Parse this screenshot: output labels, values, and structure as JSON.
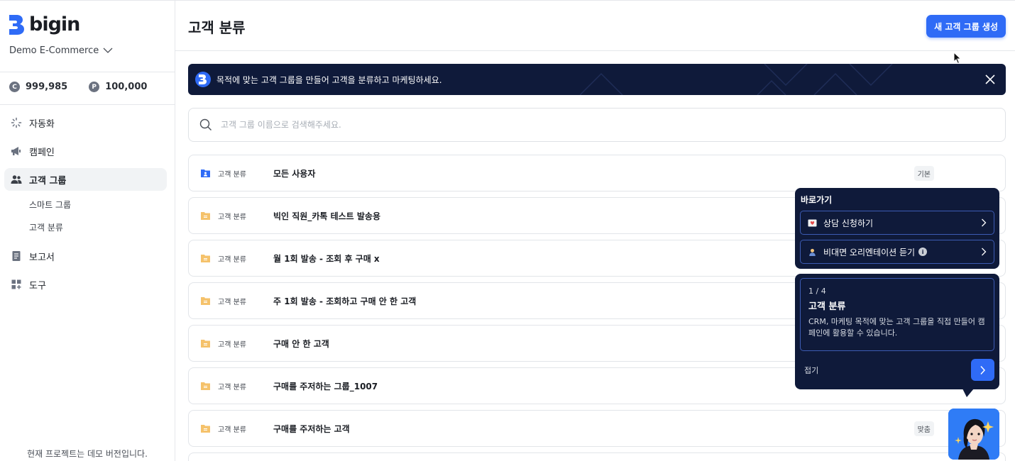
{
  "app": {
    "logo_text": "bigin",
    "workspace": "Demo E-Commerce",
    "accent_color": "#2f6bf6",
    "dark_color": "#0f1a3a"
  },
  "credits": {
    "c_value": "999,985",
    "p_value": "100,000",
    "c_symbol": "C",
    "p_symbol": "P"
  },
  "sidebar": {
    "items": [
      {
        "label": "자동화",
        "icon": "automation-icon"
      },
      {
        "label": "캠페인",
        "icon": "megaphone-icon"
      },
      {
        "label": "고객 그룹",
        "icon": "users-icon"
      },
      {
        "label": "보고서",
        "icon": "document-icon"
      },
      {
        "label": "도구",
        "icon": "grid-icon"
      }
    ],
    "sub_items": [
      "스마트 그룹",
      "고객 분류"
    ],
    "footer": "현재 프로젝트는 데모 버전입니다."
  },
  "header": {
    "title": "고객 분류",
    "create_button": "새 고객 그룹 생성"
  },
  "banner": {
    "text": "목적에 맞는 고객 그룹을 만들어 고객을 분류하고 마케팅하세요."
  },
  "search": {
    "placeholder": "고객 그룹 이름으로 검색해주세요."
  },
  "groups": [
    {
      "type": "고객 분류",
      "name": "모든 사용자",
      "badge": "기본",
      "icon_color": "#2f6bf6"
    },
    {
      "type": "고객 분류",
      "name": "빅인 직원_카톡 테스트 발송용",
      "badge": "",
      "icon_color": "#f5c26b"
    },
    {
      "type": "고객 분류",
      "name": "월 1회 발송 - 조회 후 구매 x",
      "badge": "",
      "icon_color": "#f5c26b"
    },
    {
      "type": "고객 분류",
      "name": "주 1회 발송 - 조회하고 구매 안 한 고객",
      "badge": "",
      "icon_color": "#f5c26b"
    },
    {
      "type": "고객 분류",
      "name": "구매 안 한 고객",
      "badge": "",
      "icon_color": "#f5c26b"
    },
    {
      "type": "고객 분류",
      "name": "구매를 주저하는 그룹_1007",
      "badge": "",
      "icon_color": "#f5c26b"
    },
    {
      "type": "고객 분류",
      "name": "구매를 주저하는 고객",
      "badge": "맞춤",
      "icon_color": "#f5c26b"
    }
  ],
  "shortcut": {
    "title": "바로가기",
    "items": [
      {
        "label": "상담 신청하기",
        "icon": "heart-mail-icon"
      },
      {
        "label": "비대면 오리엔테이션 듣기",
        "icon": "presenter-icon"
      }
    ],
    "info_symbol": "i"
  },
  "tour": {
    "step": "1 / 4",
    "title": "고객 분류",
    "description": "CRM, 마케팅 목적에 맞는 고객 그룹을 직접 만들어 캠페인에 활용할 수 있습니다.",
    "fold_label": "접기"
  }
}
